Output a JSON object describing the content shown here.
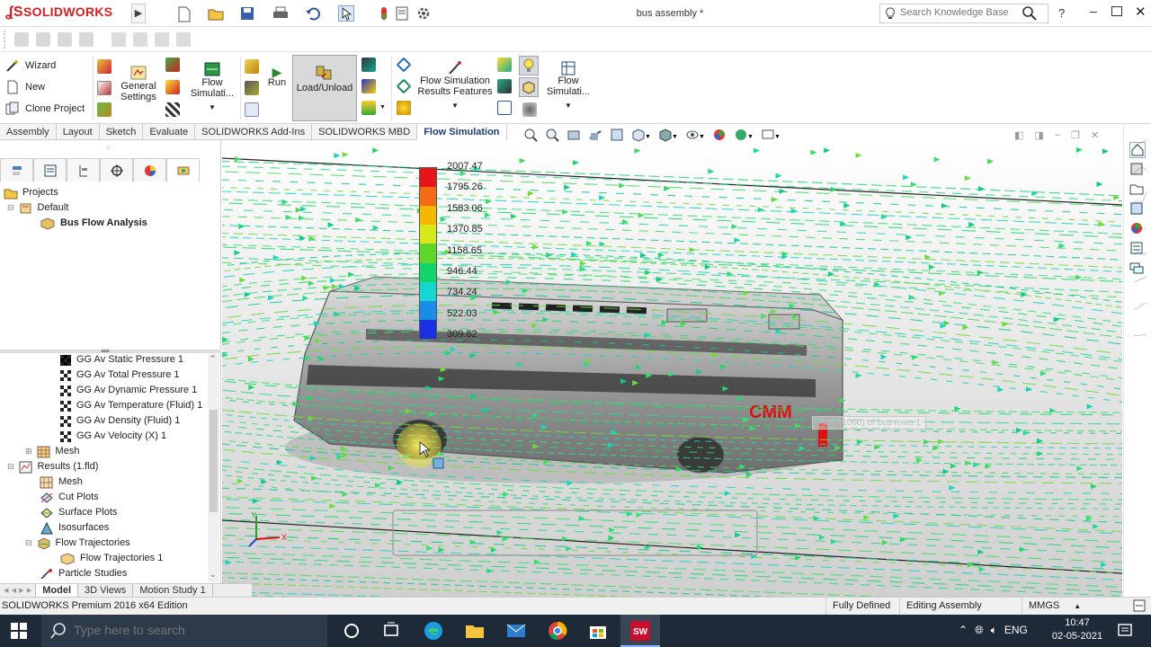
{
  "app": {
    "logo_text": "SOLIDWORKS",
    "document_title": "bus assembly *",
    "search_placeholder": "Search Knowledge Base",
    "help_label": "?"
  },
  "command_manager": {
    "wizard": "Wizard",
    "new": "New",
    "clone_project": "Clone Project",
    "general_settings_line1": "General",
    "general_settings_line2": "Settings",
    "flow_simulation_line1": "Flow",
    "flow_simulation_line2": "Simulati...",
    "run": "Run",
    "load_unload": "Load/Unload",
    "fs_results_line1": "Flow Simulation",
    "fs_results_line2": "Results Features",
    "flow_sim2_line1": "Flow",
    "flow_sim2_line2": "Simulati..."
  },
  "tabs": [
    "Assembly",
    "Layout",
    "Sketch",
    "Evaluate",
    "SOLIDWORKS Add-Ins",
    "SOLIDWORKS MBD",
    "Flow Simulation"
  ],
  "active_tab": "Flow Simulation",
  "project_tree": {
    "projects": "Projects",
    "default": "Default",
    "analysis": "Bus Flow Analysis"
  },
  "analysis_tree": {
    "goals": [
      "GG Av Static Pressure 1",
      "GG Av Total Pressure 1",
      "GG Av Dynamic Pressure 1",
      "GG Av Temperature (Fluid) 1",
      "GG Av Density (Fluid) 1",
      "GG Av Velocity (X) 1"
    ],
    "mesh": "Mesh",
    "results": "Results (1.fld)",
    "results_children": [
      "Mesh",
      "Cut Plots",
      "Surface Plots",
      "Isosurfaces",
      "Flow Trajectories"
    ],
    "flow_trajectories_child": "Flow Trajectories 1",
    "particle_studies": "Particle Studies"
  },
  "bottom_tabs": [
    "Model",
    "3D Views",
    "Motion Study 1"
  ],
  "legend": {
    "values": [
      "2007.47",
      "1795.26",
      "1583.06",
      "1370.85",
      "1158.65",
      "946.44",
      "734.24",
      "522.03",
      "309.82"
    ],
    "colors": [
      "#e8141b",
      "#f36b14",
      "#f5b800",
      "#d7e81a",
      "#5fd62a",
      "#11d66b",
      "#14d7d0",
      "#1a8ce8",
      "#1830e0"
    ]
  },
  "viewport": {
    "bus_logo": "CMM",
    "callout_text": "Flow (1000) of bus rows 1"
  },
  "triad": {
    "x": "X",
    "y": "Y"
  },
  "status_bar": {
    "edition": "SOLIDWORKS Premium 2016 x64 Edition",
    "state": "Fully Defined",
    "mode": "Editing Assembly",
    "units": "MMGS"
  },
  "taskbar": {
    "search_placeholder": "Type here to search",
    "time": "10:47",
    "date": "02-05-2021",
    "language": "ENG"
  }
}
